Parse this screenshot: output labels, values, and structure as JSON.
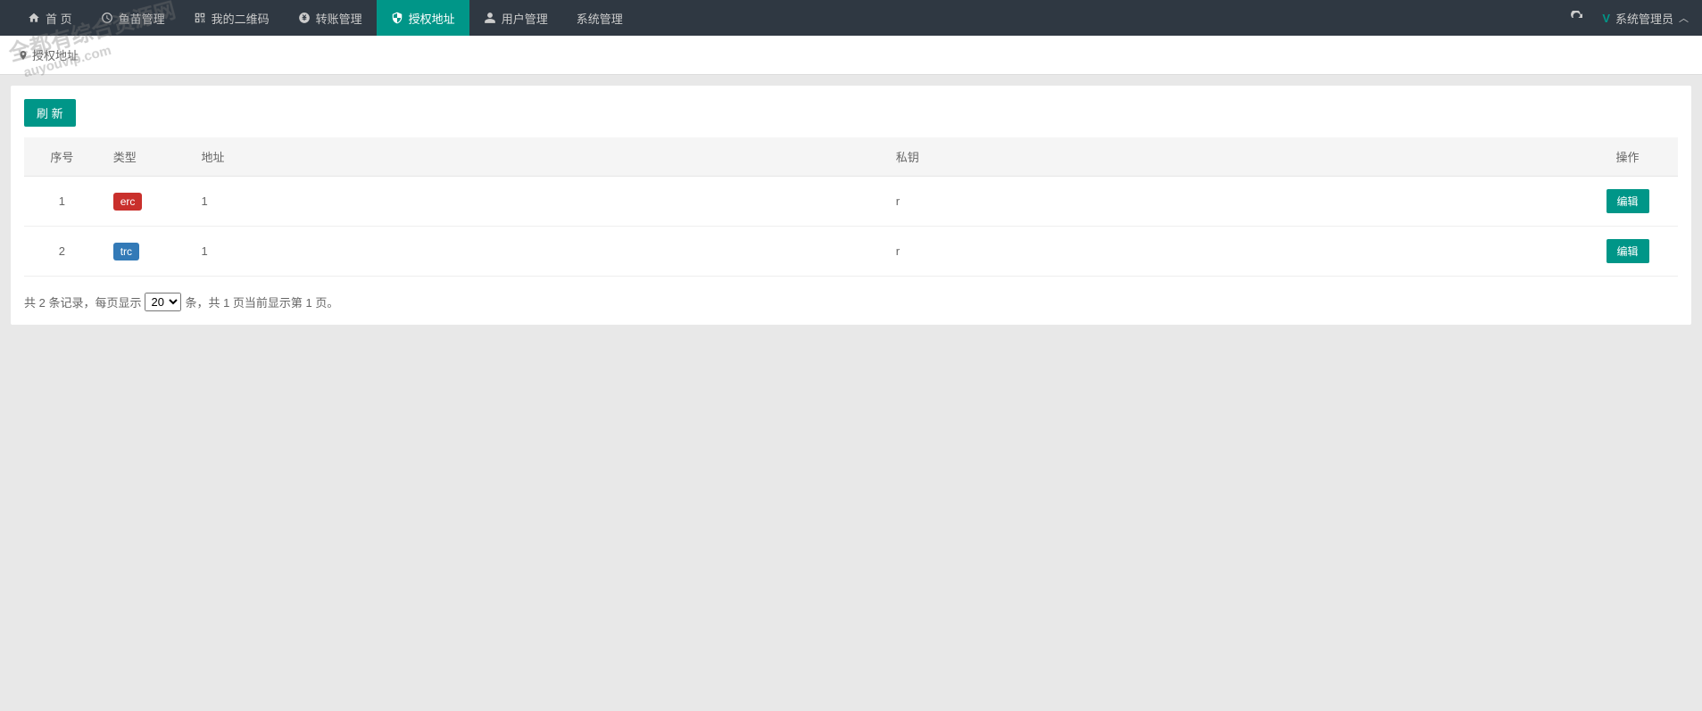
{
  "nav": {
    "items": [
      {
        "label": "首 页",
        "icon": "home"
      },
      {
        "label": "鱼苗管理",
        "icon": "clock"
      },
      {
        "label": "我的二维码",
        "icon": "qr"
      },
      {
        "label": "转账管理",
        "icon": "yen"
      },
      {
        "label": "授权地址",
        "icon": "shield",
        "active": true
      },
      {
        "label": "用户管理",
        "icon": "user"
      },
      {
        "label": "系统管理",
        "icon": ""
      }
    ],
    "user": "系统管理员"
  },
  "breadcrumb": {
    "label": "授权地址"
  },
  "toolbar": {
    "refresh_label": "刷 新"
  },
  "table": {
    "headers": {
      "seq": "序号",
      "type": "类型",
      "address": "地址",
      "key": "私钥",
      "operation": "操作"
    },
    "rows": [
      {
        "seq": "1",
        "type": "erc",
        "type_class": "erc",
        "address": "1",
        "key": "r",
        "edit": "编辑"
      },
      {
        "seq": "2",
        "type": "trc",
        "type_class": "trc",
        "address": "1",
        "key": "r",
        "edit": "编辑"
      }
    ]
  },
  "pagination": {
    "prefix": "共 2 条记录，每页显示",
    "page_size": "20",
    "suffix": "条，共 1 页当前显示第 1 页。"
  },
  "watermark": {
    "line1": "全都有综合资源网",
    "line2": "auyouvip.com"
  }
}
